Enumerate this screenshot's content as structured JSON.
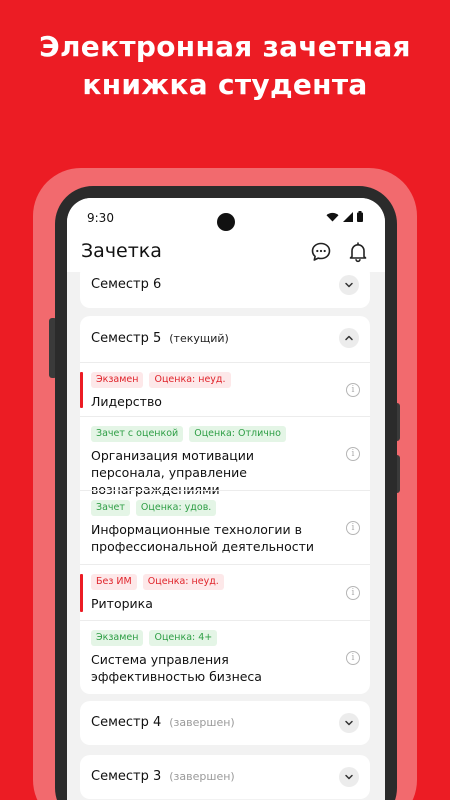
{
  "promo": {
    "line1": "Электронная зачетная",
    "line2": "книжка студента"
  },
  "status_bar": {
    "time": "9:30"
  },
  "app_bar": {
    "title": "Зачетка",
    "icons": [
      "chat-icon",
      "bell-icon"
    ]
  },
  "semesters": [
    {
      "title": "Семестр 6",
      "status": "",
      "expanded": false
    },
    {
      "title": "Семестр 5",
      "status": "(текущий)",
      "expanded": true,
      "subjects": [
        {
          "type": "Экзамен",
          "grade": "Оценка: неуд.",
          "name": "Лидерство",
          "result": "fail"
        },
        {
          "type": "Зачет с оценкой",
          "grade": "Оценка: Отлично",
          "name": "Организация мотивации персонала, управление вознаграждениями",
          "result": "pass"
        },
        {
          "type": "Зачет",
          "grade": "Оценка: удов.",
          "name": "Информационные технологии в профессиональной деятельности",
          "result": "pass"
        },
        {
          "type": "Без ИМ",
          "grade": "Оценка: неуд.",
          "name": "Риторика",
          "result": "fail"
        },
        {
          "type": "Экзамен",
          "grade": "Оценка: 4+",
          "name": "Система управления эффективностью бизнеса",
          "result": "pass"
        }
      ]
    },
    {
      "title": "Семестр 4",
      "status": "(завершен)",
      "expanded": false
    },
    {
      "title": "Семестр 3",
      "status": "(завершен)",
      "expanded": false
    }
  ],
  "colors": {
    "brand_red": "#EC1C24",
    "fail_tag_bg": "#FDE8E9",
    "pass_tag_bg": "#E4F5E6"
  }
}
